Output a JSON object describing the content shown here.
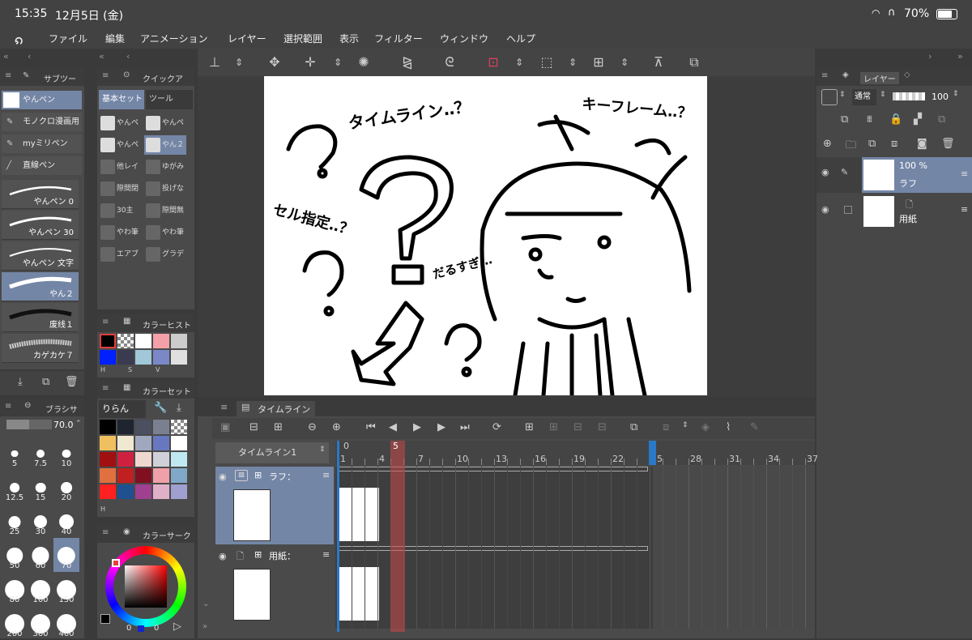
{
  "status": {
    "time": "15:35",
    "date": "12月5日 (金)",
    "battery": "70%"
  },
  "menu": [
    "ファイル",
    "編集",
    "アニメーション",
    "レイヤー",
    "選択範囲",
    "表示",
    "フィルター",
    "ウィンドウ",
    "ヘルプ"
  ],
  "subtool": {
    "title": "サブツー",
    "tools": [
      "やんペン",
      "モノクロ漫画用",
      "myミリペン",
      "直線ペン"
    ],
    "brushes": [
      "やんペン 0",
      "やんペン 30",
      "やんペン 文字",
      "やん２",
      "废线１",
      "カゲカケ７"
    ]
  },
  "quick": {
    "title": "クイックア",
    "tabs": [
      "基本セット",
      "ツール"
    ],
    "cells": [
      "やんペ",
      "やんペ",
      "やんペ",
      "やん２",
      "他レイ",
      "ゆがみ",
      "隙間閉",
      "投げな",
      "30主",
      "隙間無",
      "やわ筆",
      "やわ筆",
      "エアブ",
      "グラデ"
    ]
  },
  "colorhist": {
    "title": "カラーヒスト",
    "labels": [
      "H",
      "S",
      "V"
    ]
  },
  "colorset": {
    "title": "カラーセット",
    "set_name": "りらん",
    "label": "H"
  },
  "brushsize": {
    "title": "ブラシサ",
    "value": "70.0",
    "sizes": [
      "5",
      "7.5",
      "10",
      "12.5",
      "15",
      "20",
      "25",
      "30",
      "40",
      "50",
      "60",
      "70",
      "80",
      "100",
      "150",
      "200",
      "300",
      "400"
    ]
  },
  "colorcircle": {
    "title": "カラーサーク",
    "vals": [
      "0",
      "0"
    ]
  },
  "canvas": {
    "texts": [
      "タイムライン‥？",
      "キーフレーム‥？",
      "セル指定‥？",
      "だるすぎ…"
    ]
  },
  "layers": {
    "title": "レイヤー",
    "blend": "通常",
    "opacity": "100",
    "items": [
      {
        "pct": "100 %",
        "name": "ラフ"
      },
      {
        "name": "用紙"
      }
    ]
  },
  "timeline": {
    "title": "タイムライン",
    "name": "タイムライン1",
    "current": "5",
    "start": "0",
    "frames": [
      "1",
      "4",
      "7",
      "10",
      "13",
      "16",
      "19",
      "22",
      "25",
      "28",
      "31",
      "34",
      "37"
    ],
    "tracks": [
      "ラフ：",
      "用紙："
    ]
  },
  "colors": {
    "accent": "#7486a6",
    "playhead": "#c84848",
    "endmarker": "#2a78c8"
  }
}
